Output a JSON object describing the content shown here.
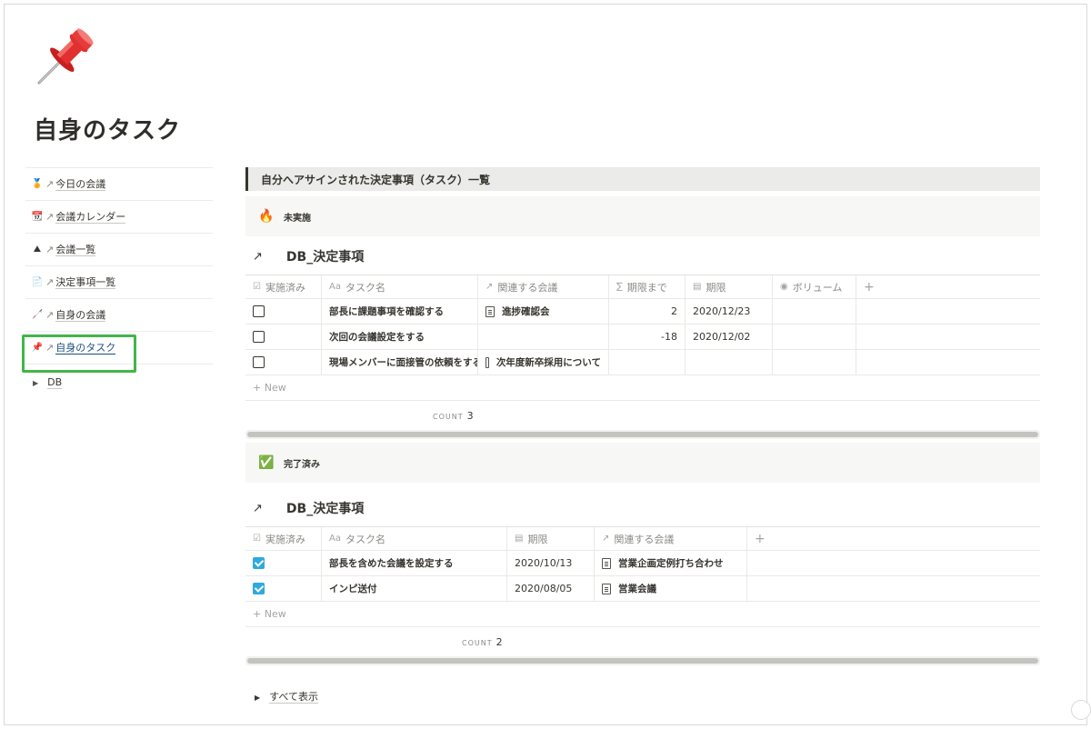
{
  "page": {
    "title": "自身のタスク"
  },
  "sidebar": {
    "items": [
      {
        "emoji": "🏅",
        "arrow": "↗",
        "label": "今日の会議"
      },
      {
        "emoji": "📆",
        "arrow": "↗",
        "label": "会議カレンダー"
      },
      {
        "emoji": "⛰",
        "arrow": "↗",
        "label": "会議一覧"
      },
      {
        "emoji": "📄",
        "arrow": "↗",
        "label": "決定事項一覧"
      },
      {
        "emoji": "🦯",
        "arrow": "↗",
        "label": "自身の会議"
      },
      {
        "emoji": "📌",
        "arrow": "↗",
        "label": "自身のタスク"
      }
    ],
    "toggle": {
      "label": "DB"
    }
  },
  "main": {
    "heading": "自分へアサインされた決定事項（タスク）一覧",
    "sections": [
      {
        "callout": {
          "emoji": "🔥",
          "label": "未実施"
        },
        "db": {
          "arrow": "↗",
          "title": "DB_決定事項",
          "columns": [
            {
              "icon": "☑",
              "label": "実施済み"
            },
            {
              "icon": "Aa",
              "label": "タスク名"
            },
            {
              "icon": "↗",
              "label": "関連する会議"
            },
            {
              "icon": "∑",
              "label": "期限まで"
            },
            {
              "icon": "▤",
              "label": "期限"
            },
            {
              "icon": "◉",
              "label": "ボリューム"
            }
          ],
          "add_column": "+",
          "rows": [
            {
              "done": false,
              "task": "部長に課題事項を確認する",
              "meeting": "進捗確認会",
              "until": "2",
              "deadline": "2020/12/23",
              "volume": ""
            },
            {
              "done": false,
              "task": "次回の会議設定をする",
              "meeting": "",
              "until": "-18",
              "deadline": "2020/12/02",
              "volume": ""
            },
            {
              "done": false,
              "task": "現場メンバーに面接管の依頼をする",
              "meeting": "次年度新卒採用について",
              "until": "",
              "deadline": "",
              "volume": ""
            }
          ],
          "new_label": "+ New",
          "count_label": "COUNT",
          "count_value": "3"
        }
      },
      {
        "callout": {
          "emoji": "✅",
          "label": "完了済み"
        },
        "db": {
          "arrow": "↗",
          "title": "DB_決定事項",
          "columns": [
            {
              "icon": "☑",
              "label": "実施済み"
            },
            {
              "icon": "Aa",
              "label": "タスク名"
            },
            {
              "icon": "▤",
              "label": "期限"
            },
            {
              "icon": "↗",
              "label": "関連する会議"
            }
          ],
          "add_column": "+",
          "rows": [
            {
              "done": true,
              "task": "部長を含めた会議を設定する",
              "deadline": "2020/10/13",
              "meeting": "営業企画定例打ち合わせ"
            },
            {
              "done": true,
              "task": "インピ送付",
              "deadline": "2020/08/05",
              "meeting": "営業会議"
            }
          ],
          "new_label": "+ New",
          "count_label": "COUNT",
          "count_value": "2"
        }
      }
    ],
    "show_all": "すべて表示"
  },
  "colors": {
    "accent_green": "#43b54a",
    "checkbox_blue": "#2eaadc",
    "heading_bg": "#ebebea"
  }
}
